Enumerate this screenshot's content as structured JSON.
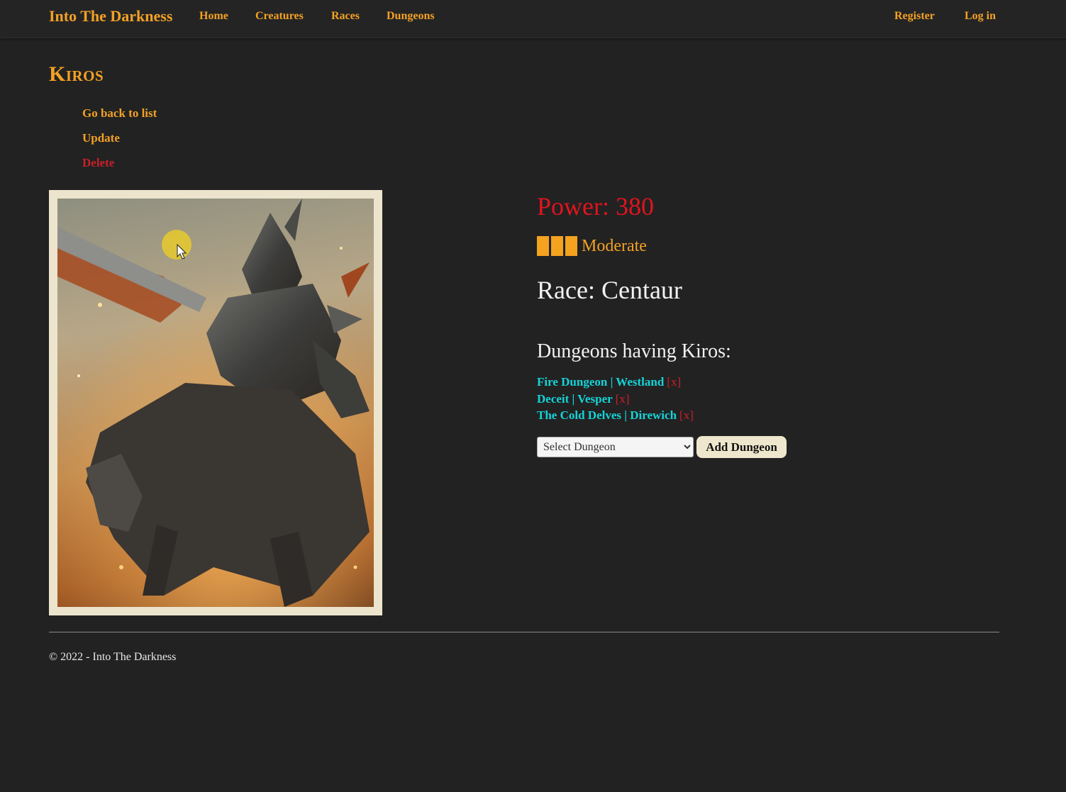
{
  "navbar": {
    "brand": "Into The Darkness",
    "links": [
      {
        "label": "Home"
      },
      {
        "label": "Creatures"
      },
      {
        "label": "Races"
      },
      {
        "label": "Dungeons"
      }
    ],
    "right_links": [
      {
        "label": "Register"
      },
      {
        "label": "Log in"
      }
    ]
  },
  "creature": {
    "name": "Kiros",
    "power_text": "Power: 380",
    "threat": {
      "bars": 3,
      "label": "Moderate",
      "color": "#f5a21f"
    },
    "race_text": "Race: Centaur",
    "image_icon": "armored-centaur-portrait"
  },
  "actions": {
    "back": "Go back to list",
    "update": "Update",
    "delete": "Delete"
  },
  "dungeons": {
    "heading": "Dungeons having Kiros:",
    "items": [
      {
        "name": "Fire Dungeon | Westland",
        "remove": "[x]"
      },
      {
        "name": "Deceit | Vesper",
        "remove": "[x]"
      },
      {
        "name": "The Cold Delves | Direwich",
        "remove": "[x]"
      }
    ],
    "select_value": "Select Dungeon",
    "add_button": "Add Dungeon"
  },
  "footer": {
    "text": "© 2022 - Into The Darkness"
  },
  "colors": {
    "background": "#222222",
    "accent": "#f3a125",
    "danger": "#c8202a",
    "power": "#e0141e",
    "link": "#14d4d8"
  }
}
